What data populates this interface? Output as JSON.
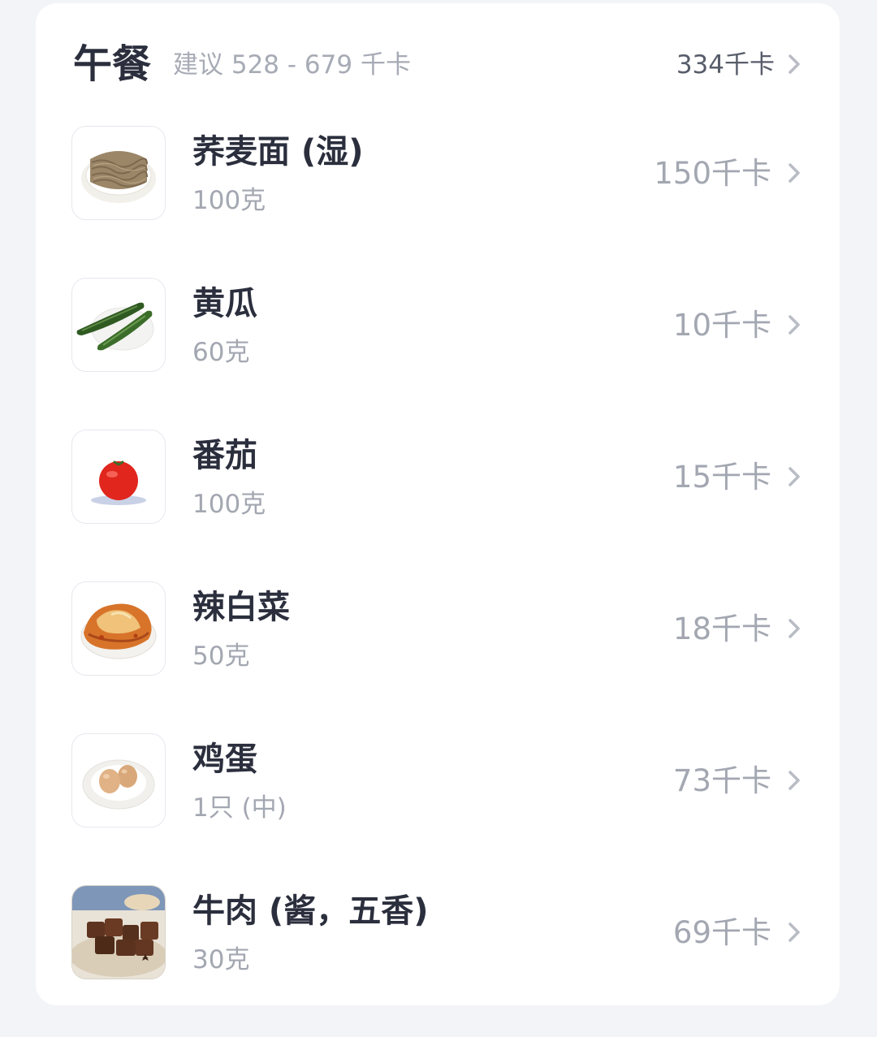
{
  "meal": {
    "title": "午餐",
    "suggestion": "建议 528 - 679 千卡",
    "total": "334千卡"
  },
  "foods": [
    {
      "name": "荞麦面 (湿)",
      "amount": "100克",
      "kcal": "150千卡",
      "icon": "buckwheat-noodles-icon"
    },
    {
      "name": "黄瓜",
      "amount": "60克",
      "kcal": "10千卡",
      "icon": "cucumber-icon"
    },
    {
      "name": "番茄",
      "amount": "100克",
      "kcal": "15千卡",
      "icon": "tomato-icon"
    },
    {
      "name": "辣白菜",
      "amount": "50克",
      "kcal": "18千卡",
      "icon": "kimchi-icon"
    },
    {
      "name": "鸡蛋",
      "amount": "1只 (中)",
      "kcal": "73千卡",
      "icon": "eggs-icon"
    },
    {
      "name": "牛肉 (酱，五香)",
      "amount": "30克",
      "kcal": "69千卡",
      "icon": "braised-beef-icon"
    }
  ],
  "colors": {
    "background": "#f3f4f8",
    "card": "#ffffff",
    "title": "#2b2f3d",
    "secondary": "#a3a7b1",
    "chevron": "#b9bcc5"
  }
}
